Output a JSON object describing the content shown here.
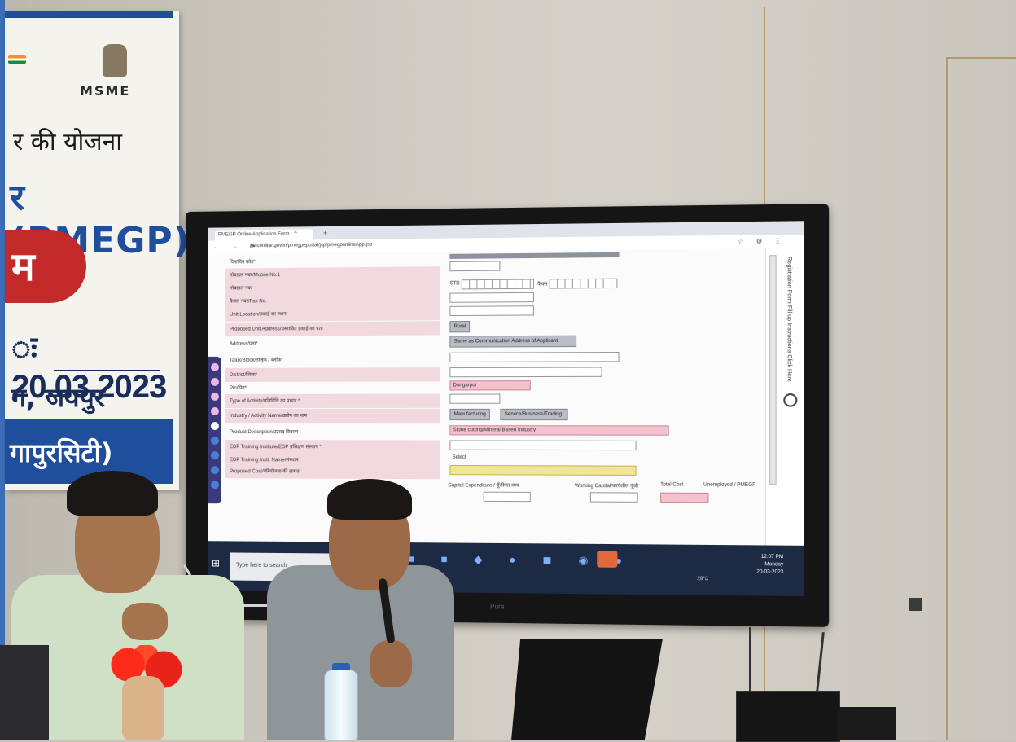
{
  "banner": {
    "scheme_text": "र की योजना",
    "program_text": "र (PMEGP)",
    "badge_text": "म",
    "date_text": "ः 20.03.2023",
    "place_text": "ग, जयपुर",
    "district_text": "गापुरसिटी)",
    "logo_text": "MSME"
  },
  "browser": {
    "tab_label": "PMEGP Online Application Form",
    "url": "kviconline.gov.in/pmegpeportal/jsp/pmegponlineApp.jsp",
    "nav_icons": "← → ⟳ ⌂",
    "ext_icons": "☆ ⚙ ⋮"
  },
  "form": {
    "rows": [
      {
        "num": "",
        "label": "पिन/पिन कोड*"
      },
      {
        "num": "",
        "label": "मोबाइल नंबर/Mobile No.1"
      },
      {
        "num": "",
        "label": "मोबाइल नंबर"
      },
      {
        "num": "",
        "label": "फैक्स नंबर/Fax No."
      },
      {
        "num": "",
        "label": "Unit Location/इकाई का स्थान"
      },
      {
        "num": "",
        "label": "Proposed Unit Address/प्रस्तावित इकाई का पता"
      },
      {
        "num": "",
        "label": "Address/पता*"
      },
      {
        "num": "",
        "label": "Taluk/Block/तालुक / ब्लॉक*"
      },
      {
        "num": "",
        "label": "District/जिला*"
      },
      {
        "num": "",
        "label": "Pin/पिन*"
      },
      {
        "num": "",
        "label": "Type of Activity/गतिविधि का प्रकार *"
      },
      {
        "num": "",
        "label": "Industry / Activity Name/उद्योग का नाम"
      },
      {
        "num": "",
        "label": "Product Description/उत्पाद विवरण"
      },
      {
        "num": "",
        "label": "EDP Training Institute/EDP प्रशिक्षण संस्थान *"
      },
      {
        "num": "",
        "label": "EDP Training Insti. Name/संस्थान"
      },
      {
        "num": "",
        "label": "Proposed Cost/परियोजना की लागत"
      }
    ],
    "std_label": "STD",
    "fax_label": "फैक्स",
    "rural_button": "Rural",
    "same_as_communication": "Same as Communication Address of Applicant",
    "district_value": "Dungarpur",
    "manufacturing_button": "Manufacturing",
    "service_button": "Service/Business/Trading",
    "industry_value": "Stone cutting/Mineral Based Industry",
    "edp_value": "Select",
    "capital_expenditure": "Capital Expenditure / पूँजीगत व्यय",
    "working_capital": "Working Capital/कार्यशील पूंजी",
    "total_label": "Total Cost",
    "unemployment_label": "Unemployed / PMEGP"
  },
  "side_panel": {
    "vertical_text": "Registration Form Fill up Instructions Click Here"
  },
  "taskbar": {
    "search_placeholder": "Type here to search",
    "weather": "29°C",
    "time": "12:07 PM",
    "day": "Monday",
    "date": "20-03-2023"
  },
  "tv": {
    "brand": "Pure"
  }
}
